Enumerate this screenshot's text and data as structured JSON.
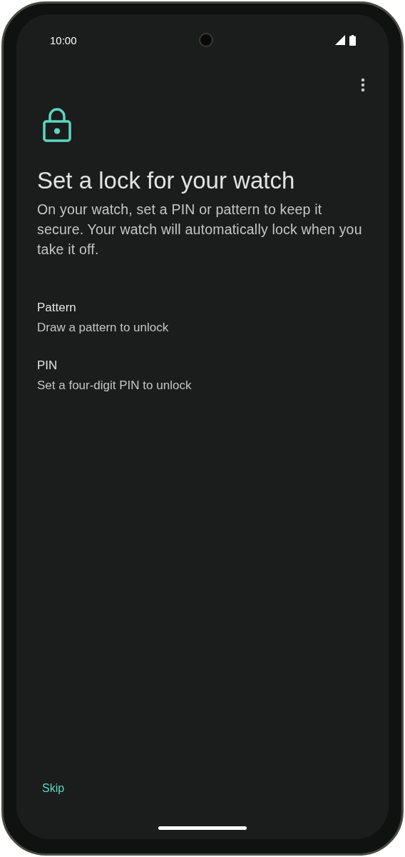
{
  "status_bar": {
    "time": "10:00"
  },
  "title": "Set a lock for your watch",
  "description": "On your watch, set a PIN or pattern to keep it secure. Your watch will automatically lock when you take it off.",
  "options": [
    {
      "title": "Pattern",
      "subtitle": "Draw a pattern to unlock"
    },
    {
      "title": "PIN",
      "subtitle": "Set a four-digit PIN to unlock"
    }
  ],
  "skip_button": "Skip"
}
